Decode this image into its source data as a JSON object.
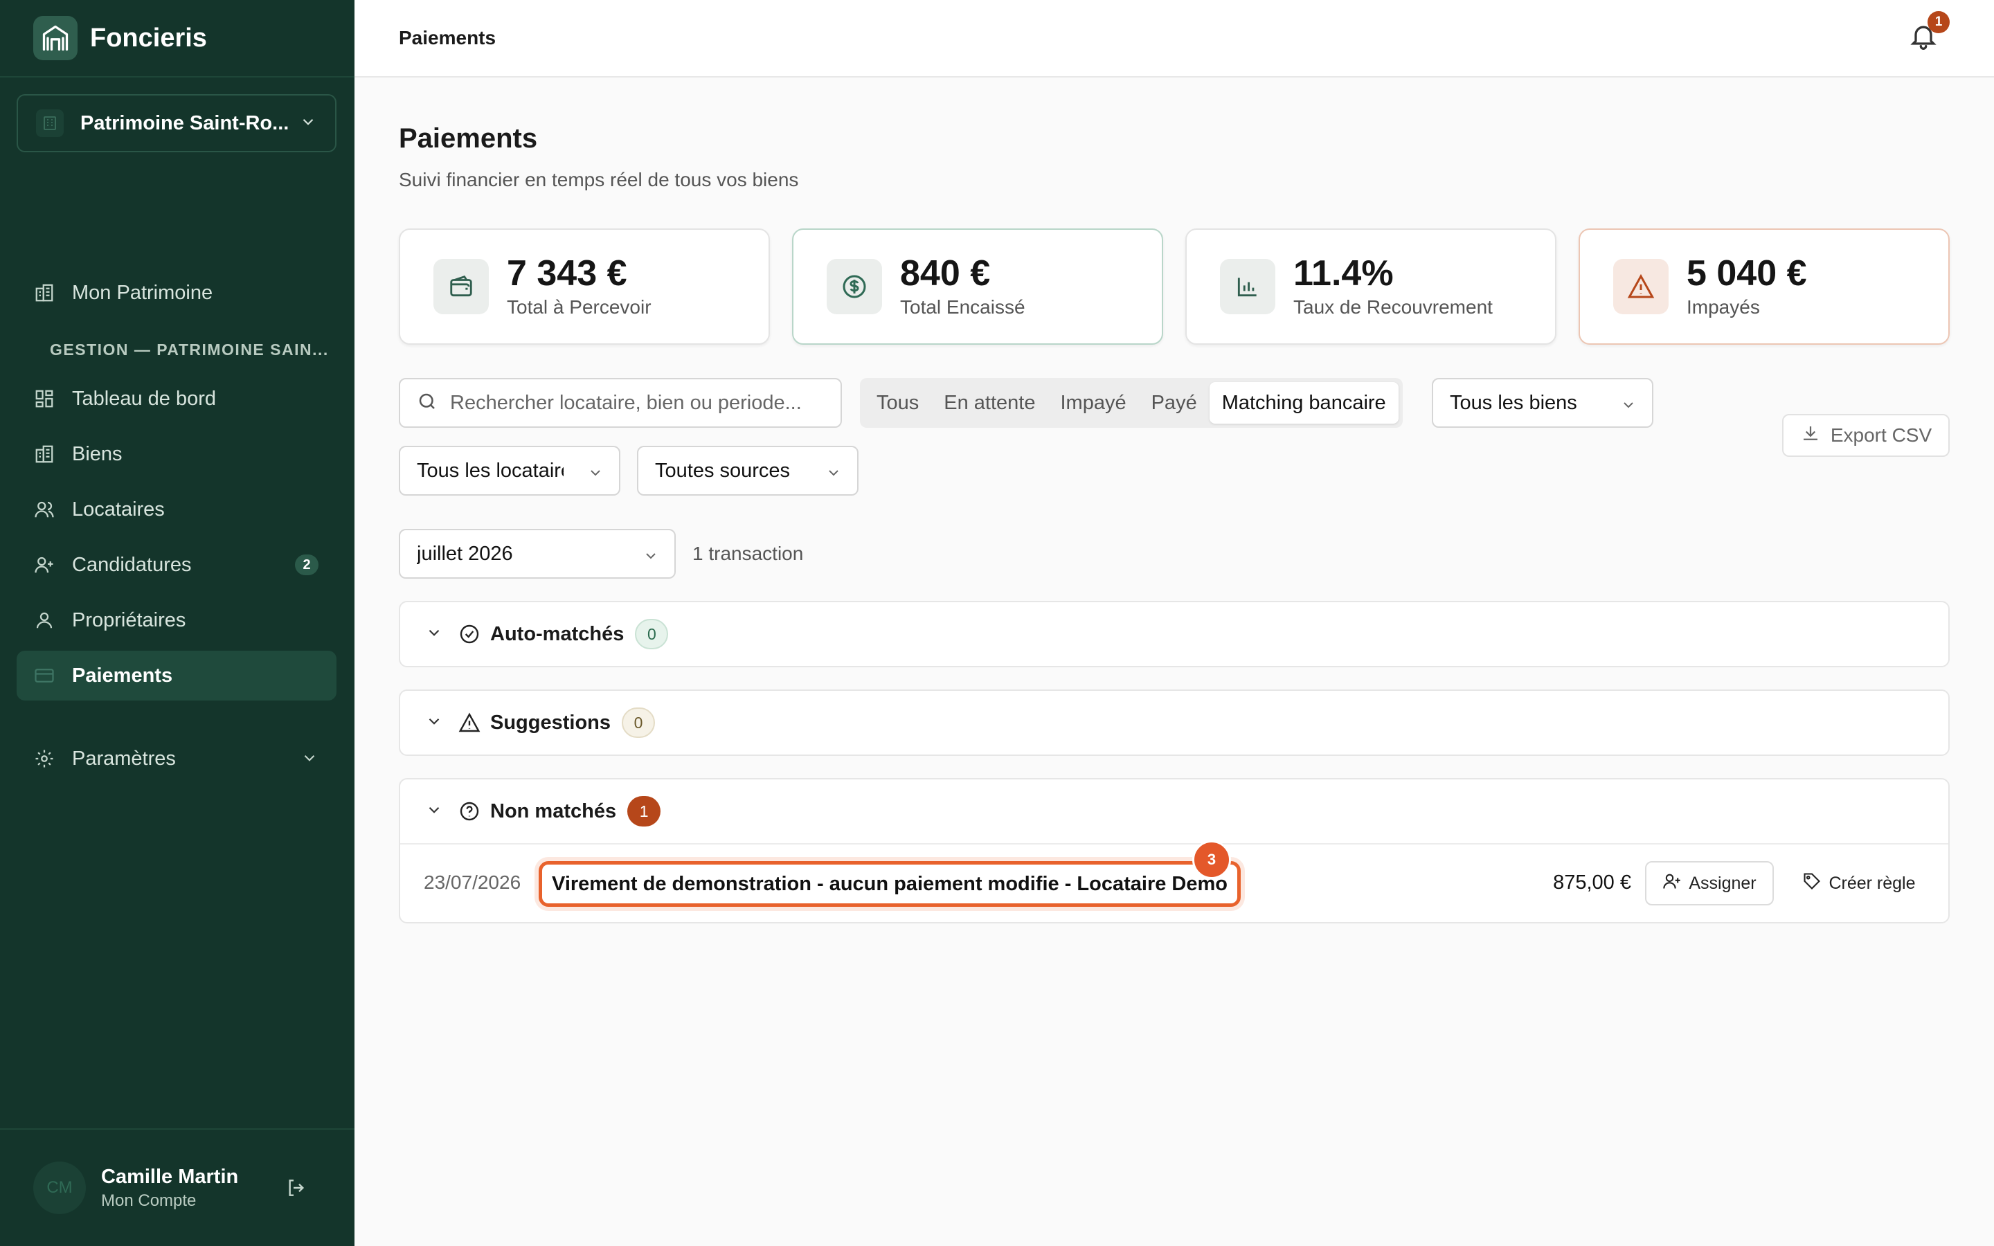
{
  "app": {
    "name": "Foncieris"
  },
  "org": {
    "label": "Patrimoine Saint-Ro..."
  },
  "nav": {
    "top": {
      "label": "Mon Patrimoine"
    },
    "section_label": "GESTION — PATRIMOINE SAIN...",
    "items": [
      {
        "label": "Tableau de bord",
        "icon": "dashboard-icon"
      },
      {
        "label": "Biens",
        "icon": "building-icon"
      },
      {
        "label": "Locataires",
        "icon": "users-icon"
      },
      {
        "label": "Candidatures",
        "icon": "user-plus-icon",
        "badge": "2"
      },
      {
        "label": "Propriétaires",
        "icon": "user-icon"
      },
      {
        "label": "Paiements",
        "icon": "card-icon",
        "active": true
      }
    ],
    "settings": {
      "label": "Paramètres"
    }
  },
  "user": {
    "name": "Camille Martin",
    "sub": "Mon Compte",
    "initials": "CM"
  },
  "topbar": {
    "title": "Paiements",
    "notification_count": "1"
  },
  "page": {
    "title": "Paiements",
    "subtitle": "Suivi financier en temps réel de tous vos biens"
  },
  "kpis": [
    {
      "value": "7 343 €",
      "label": "Total à Percevoir",
      "icon": "wallet-icon"
    },
    {
      "value": "840 €",
      "label": "Total Encaissé",
      "icon": "dollar-circle-icon"
    },
    {
      "value": "11.4%",
      "label": "Taux de Recouvrement",
      "icon": "bar-chart-icon"
    },
    {
      "value": "5 040 €",
      "label": "Impayés",
      "icon": "warning-icon"
    }
  ],
  "filters": {
    "search_placeholder": "Rechercher locataire, bien ou periode...",
    "tabs": [
      "Tous",
      "En attente",
      "Impayé",
      "Payé",
      "Matching bancaire"
    ],
    "active_tab": "Matching bancaire",
    "biens": "Tous les biens",
    "locataires": "Tous les locataires",
    "sources": "Toutes sources",
    "export_label": "Export CSV",
    "month": "juillet 2026",
    "tx_count": "1 transaction"
  },
  "groups": {
    "auto": {
      "label": "Auto-matchés",
      "count": "0"
    },
    "suggestions": {
      "label": "Suggestions",
      "count": "0"
    },
    "unmatched": {
      "label": "Non matchés",
      "count": "1"
    }
  },
  "transaction": {
    "date": "23/07/2026",
    "description": "Virement de demonstration - aucun paiement modifie - Locataire Demo",
    "amount": "875,00 €",
    "assign_label": "Assigner",
    "rule_label": "Créer règle",
    "marker": "3"
  },
  "colors": {
    "sidebar": "#14352b",
    "accent_red": "#b6471a",
    "highlight": "#e8622c"
  }
}
